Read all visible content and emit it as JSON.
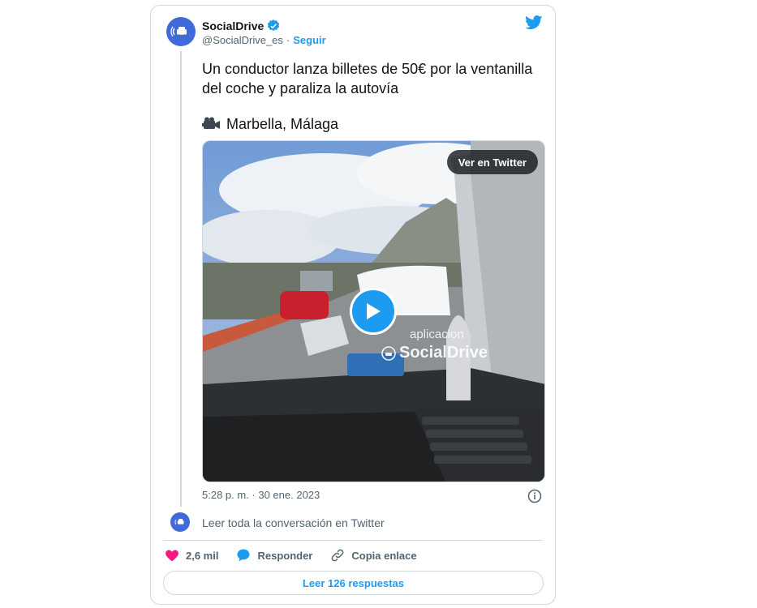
{
  "tweet": {
    "author_name": "SocialDrive",
    "author_handle": "@SocialDrive_es",
    "separator": "·",
    "follow_label": "Seguir",
    "verified_icon": "verified-badge-icon",
    "platform_icon": "twitter-bird-icon",
    "text_line": "Un conductor lanza billetes de 50€ por la ventanilla del coche y paraliza la autovía",
    "location_icon": "video-camera-emoji",
    "location": "Marbella, Málaga",
    "timestamp": "5:28 p. m. · 30 ene. 2023",
    "read_conversation": "Leer toda la conversación en Twitter"
  },
  "media": {
    "view_on_twitter": "Ver en Twitter",
    "watermark_line1": "aplicacion",
    "watermark_line2": "SocialDrive",
    "play_icon": "play-icon"
  },
  "actions": {
    "likes": "2,6 mil",
    "reply": "Responder",
    "copy_link": "Copia enlace",
    "read_replies": "Leer 126 respuestas"
  },
  "colors": {
    "accent": "#1d9bf0",
    "like": "#f91880",
    "brand": "#3f6ad8"
  }
}
